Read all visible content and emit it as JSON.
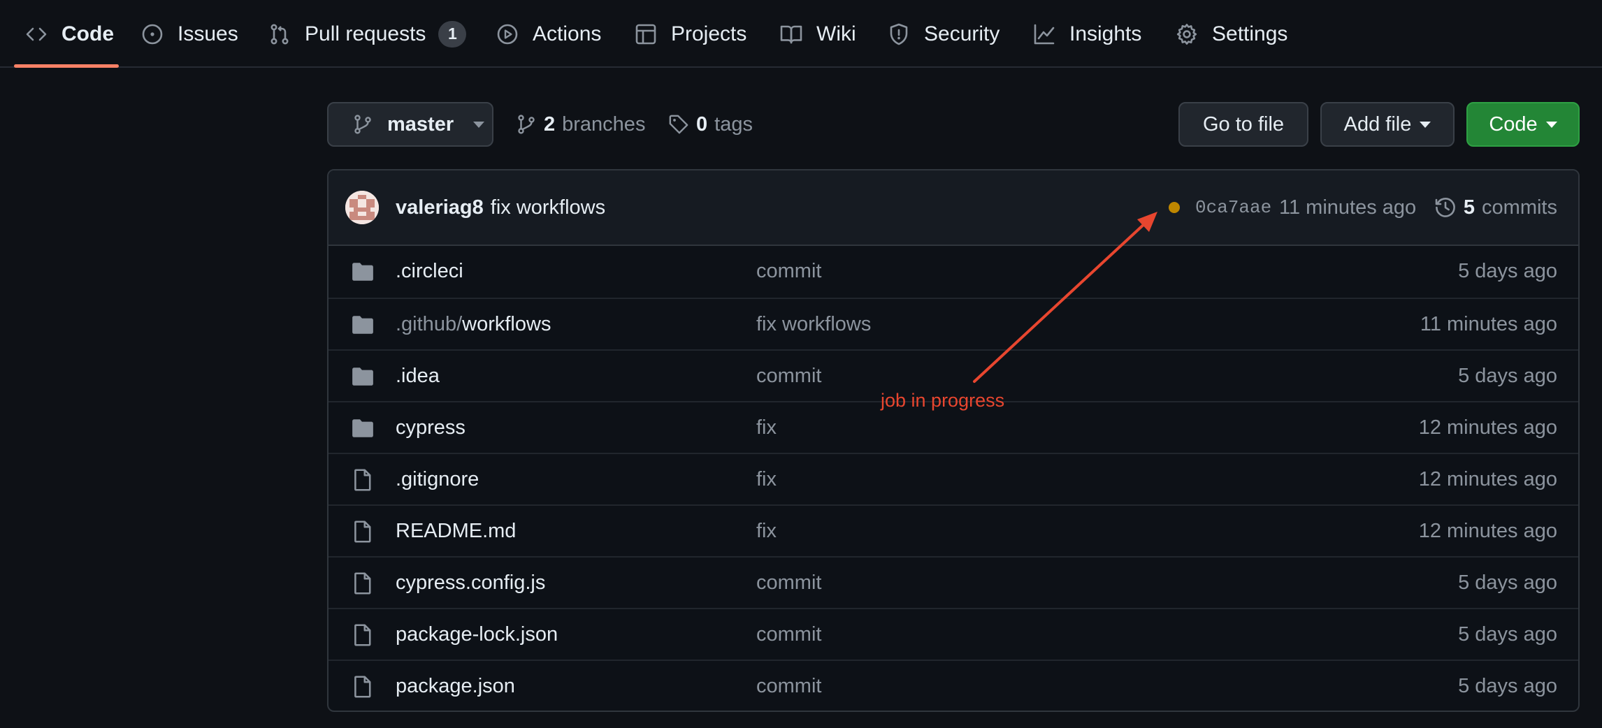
{
  "nav": {
    "items": [
      {
        "label": "Code",
        "icon": "code-icon"
      },
      {
        "label": "Issues",
        "icon": "issue-icon"
      },
      {
        "label": "Pull requests",
        "icon": "pull-request-icon",
        "count": "1"
      },
      {
        "label": "Actions",
        "icon": "play-icon"
      },
      {
        "label": "Projects",
        "icon": "table-icon"
      },
      {
        "label": "Wiki",
        "icon": "book-icon"
      },
      {
        "label": "Security",
        "icon": "shield-icon"
      },
      {
        "label": "Insights",
        "icon": "graph-icon"
      },
      {
        "label": "Settings",
        "icon": "gear-icon"
      }
    ],
    "active": "Code"
  },
  "toolbar": {
    "branch": "master",
    "branches_count": "2",
    "branches_label": "branches",
    "tags_count": "0",
    "tags_label": "tags",
    "go_to_file": "Go to file",
    "add_file": "Add file",
    "code": "Code"
  },
  "latest_commit": {
    "author": "valeriag8",
    "message": "fix workflows",
    "sha": "0ca7aae",
    "time": "11 minutes ago",
    "commits_count": "5",
    "commits_label": "commits",
    "status": "pending"
  },
  "files": [
    {
      "type": "folder",
      "name": ".circleci",
      "message": "commit",
      "age": "5 days ago"
    },
    {
      "type": "folder",
      "name_prefix": ".github/",
      "name": "workflows",
      "message": "fix workflows",
      "age": "11 minutes ago"
    },
    {
      "type": "folder",
      "name": ".idea",
      "message": "commit",
      "age": "5 days ago"
    },
    {
      "type": "folder",
      "name": "cypress",
      "message": "fix",
      "age": "12 minutes ago"
    },
    {
      "type": "file",
      "name": ".gitignore",
      "message": "fix",
      "age": "12 minutes ago"
    },
    {
      "type": "file",
      "name": "README.md",
      "message": "fix",
      "age": "12 minutes ago"
    },
    {
      "type": "file",
      "name": "cypress.config.js",
      "message": "commit",
      "age": "5 days ago"
    },
    {
      "type": "file",
      "name": "package-lock.json",
      "message": "commit",
      "age": "5 days ago"
    },
    {
      "type": "file",
      "name": "package.json",
      "message": "commit",
      "age": "5 days ago"
    }
  ],
  "annotation": {
    "label": "job in progress",
    "color": "#e8462f"
  },
  "colors": {
    "background": "#0e1116",
    "accent_underline": "#f78166",
    "primary_button": "#238636",
    "pending_dot": "#bf8700"
  }
}
